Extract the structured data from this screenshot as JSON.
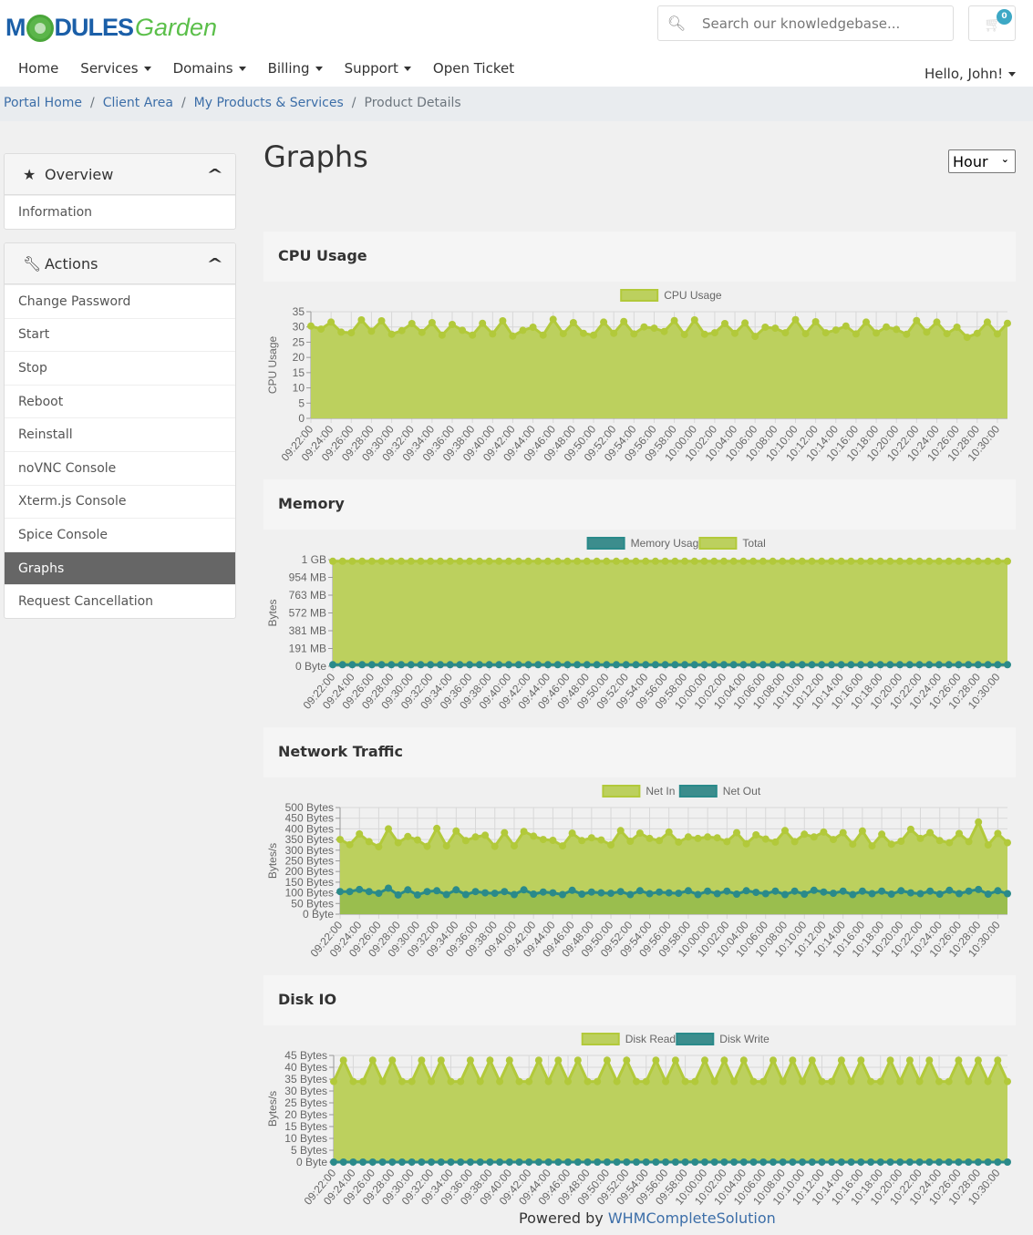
{
  "header": {
    "logo_text_1": "M",
    "logo_text_2": "DULES",
    "logo_text_3": "Garden",
    "search_placeholder": "Search our knowledgebase...",
    "cart_count": "0",
    "nav": [
      {
        "label": "Home",
        "dropdown": false
      },
      {
        "label": "Services",
        "dropdown": true
      },
      {
        "label": "Domains",
        "dropdown": true
      },
      {
        "label": "Billing",
        "dropdown": true
      },
      {
        "label": "Support",
        "dropdown": true
      },
      {
        "label": "Open Ticket",
        "dropdown": false
      }
    ],
    "user_menu": "Hello, John!"
  },
  "breadcrumb": [
    "Portal Home",
    "Client Area",
    "My Products & Services",
    "Product Details"
  ],
  "sidebar": {
    "overview": {
      "title": "Overview",
      "items": [
        "Information"
      ]
    },
    "actions": {
      "title": "Actions",
      "items": [
        "Change Password",
        "Start",
        "Stop",
        "Reboot",
        "Reinstall",
        "noVNC Console",
        "Xterm.js Console",
        "Spice Console",
        "Graphs",
        "Request Cancellation"
      ],
      "active": "Graphs"
    }
  },
  "main": {
    "title": "Graphs",
    "period_select": "Hour"
  },
  "colors": {
    "green": "#b2c93a",
    "green_fill": "#bcd05e",
    "teal": "#2a8a8a",
    "teal_fill": "#8fb84a"
  },
  "chart_data": [
    {
      "type": "area",
      "title": "CPU Usage",
      "ylabel": "CPU Usage",
      "ylim": [
        0,
        35
      ],
      "yticks": [
        "0",
        "5",
        "10",
        "15",
        "20",
        "25",
        "30",
        "35"
      ],
      "xticks": [
        "09:22:00",
        "09:24:00",
        "09:26:00",
        "09:28:00",
        "09:30:00",
        "09:32:00",
        "09:34:00",
        "09:36:00",
        "09:38:00",
        "09:40:00",
        "09:42:00",
        "09:44:00",
        "09:46:00",
        "09:48:00",
        "09:50:00",
        "09:52:00",
        "09:54:00",
        "09:56:00",
        "09:58:00",
        "10:00:00",
        "10:02:00",
        "10:04:00",
        "10:06:00",
        "10:08:00",
        "10:10:00",
        "10:12:00",
        "10:14:00",
        "10:16:00",
        "10:18:00",
        "10:20:00",
        "10:22:00",
        "10:24:00",
        "10:26:00",
        "10:28:00",
        "10:30:00"
      ],
      "x_start": "09:22",
      "x_interval_min": 1,
      "grid": true,
      "legend": "top-center",
      "series": [
        {
          "name": "CPU Usage",
          "color": "#b2c93a",
          "values": [
            30.3,
            29.3,
            31.6,
            28.3,
            28.1,
            32.3,
            28.6,
            32.0,
            27.6,
            28.8,
            31.1,
            28.2,
            31.4,
            27.3,
            30.8,
            28.9,
            27.3,
            31.2,
            27.7,
            32.0,
            27.0,
            28.9,
            29.9,
            27.3,
            32.5,
            27.8,
            31.4,
            27.9,
            27.3,
            31.6,
            27.9,
            31.8,
            27.7,
            30.0,
            29.6,
            28.5,
            32.1,
            27.5,
            32.3,
            27.6,
            28.1,
            31.1,
            27.9,
            31.3,
            26.9,
            29.9,
            29.6,
            28.1,
            32.4,
            27.8,
            31.7,
            28.1,
            29.0,
            30.3,
            27.7,
            31.6,
            28.0,
            30.0,
            29.2,
            27.6,
            32.1,
            28.3,
            31.6,
            27.8,
            29.9,
            26.6,
            27.9,
            31.6,
            27.7,
            31.2
          ]
        }
      ]
    },
    {
      "type": "area",
      "title": "Memory",
      "ylabel": "Bytes",
      "ylim": [
        0,
        1073741824
      ],
      "yticks": [
        "0 Byte",
        "191 MB",
        "381 MB",
        "572 MB",
        "763 MB",
        "954 MB",
        "1 GB"
      ],
      "x_start": "09:22",
      "x_interval_min": 1,
      "grid": true,
      "legend": "top-center",
      "series": [
        {
          "name": "Memory Usage",
          "color": "#2a8a8a",
          "constant_value_mb": 15
        },
        {
          "name": "Total",
          "color": "#b2c93a",
          "constant_value_mb": 1008
        }
      ]
    },
    {
      "type": "area",
      "title": "Network Traffic",
      "ylabel": "Bytes/s",
      "ylim": [
        0,
        500
      ],
      "yticks": [
        "0 Byte",
        "50 Bytes",
        "100 Bytes",
        "150 Bytes",
        "200 Bytes",
        "250 Bytes",
        "300 Bytes",
        "350 Bytes",
        "400 Bytes",
        "450 Bytes",
        "500 Bytes"
      ],
      "x_start": "09:22",
      "x_interval_min": 1,
      "grid": true,
      "legend": "top-center",
      "series": [
        {
          "name": "Net In",
          "color": "#b2c93a",
          "values": [
            350,
            326,
            376,
            340,
            316,
            400,
            335,
            364,
            348,
            318,
            402,
            320,
            390,
            345,
            362,
            370,
            318,
            382,
            320,
            388,
            366,
            350,
            346,
            320,
            380,
            345,
            358,
            348,
            325,
            392,
            342,
            380,
            355,
            345,
            385,
            338,
            362,
            355,
            362,
            358,
            340,
            382,
            330,
            372,
            352,
            338,
            392,
            340,
            375,
            362,
            385,
            350,
            382,
            328,
            390,
            320,
            375,
            328,
            342,
            398,
            355,
            382,
            345,
            335,
            378,
            340,
            432,
            325,
            378,
            335
          ],
          "values_note": "approximate"
        },
        {
          "name": "Net Out",
          "color": "#2a8a8a",
          "values": [
            106,
            106,
            116,
            106,
            98,
            122,
            90,
            114,
            90,
            106,
            110,
            92,
            114,
            92,
            106,
            100,
            98,
            106,
            92,
            114,
            94,
            104,
            100,
            92,
            112,
            94,
            104,
            100,
            98,
            106,
            92,
            110,
            96,
            104,
            100,
            98,
            110,
            92,
            108,
            96,
            108,
            94,
            110,
            102,
            96,
            108,
            92,
            108,
            94,
            112,
            104,
            98,
            108,
            92,
            108,
            96,
            108,
            94,
            110,
            100,
            96,
            108,
            94,
            112,
            96,
            108,
            116,
            94,
            110,
            96
          ]
        }
      ]
    },
    {
      "type": "area",
      "title": "Disk IO",
      "ylabel": "Bytes/s",
      "ylim": [
        0,
        45
      ],
      "yticks": [
        "0 Byte",
        "5 Bytes",
        "10 Bytes",
        "15 Bytes",
        "20 Bytes",
        "25 Bytes",
        "30 Bytes",
        "35 Bytes",
        "40 Bytes",
        "45 Bytes"
      ],
      "x_start": "09:22",
      "x_interval_min": 1,
      "grid": true,
      "legend": "top-center",
      "series": [
        {
          "name": "Disk Read",
          "color": "#b2c93a",
          "values": [
            34,
            43,
            34,
            34,
            43,
            34,
            43,
            34,
            34,
            43,
            34,
            43,
            34,
            34,
            43,
            34,
            43,
            34,
            43,
            34,
            34,
            43,
            34,
            43,
            34,
            43,
            34,
            34,
            43,
            34,
            43,
            34,
            34,
            43,
            34,
            43,
            34,
            34,
            43,
            34,
            43,
            34,
            43,
            34,
            34,
            43,
            34,
            43,
            34,
            43,
            34,
            34,
            43,
            34,
            43,
            34,
            34,
            43,
            34,
            43,
            34,
            43,
            34,
            34,
            43,
            34,
            43,
            34,
            43,
            34
          ]
        },
        {
          "name": "Disk Write",
          "color": "#2a8a8a",
          "constant_value": 0
        }
      ]
    }
  ],
  "footer": {
    "prefix": "Powered by ",
    "link": "WHMCompleteSolution"
  }
}
